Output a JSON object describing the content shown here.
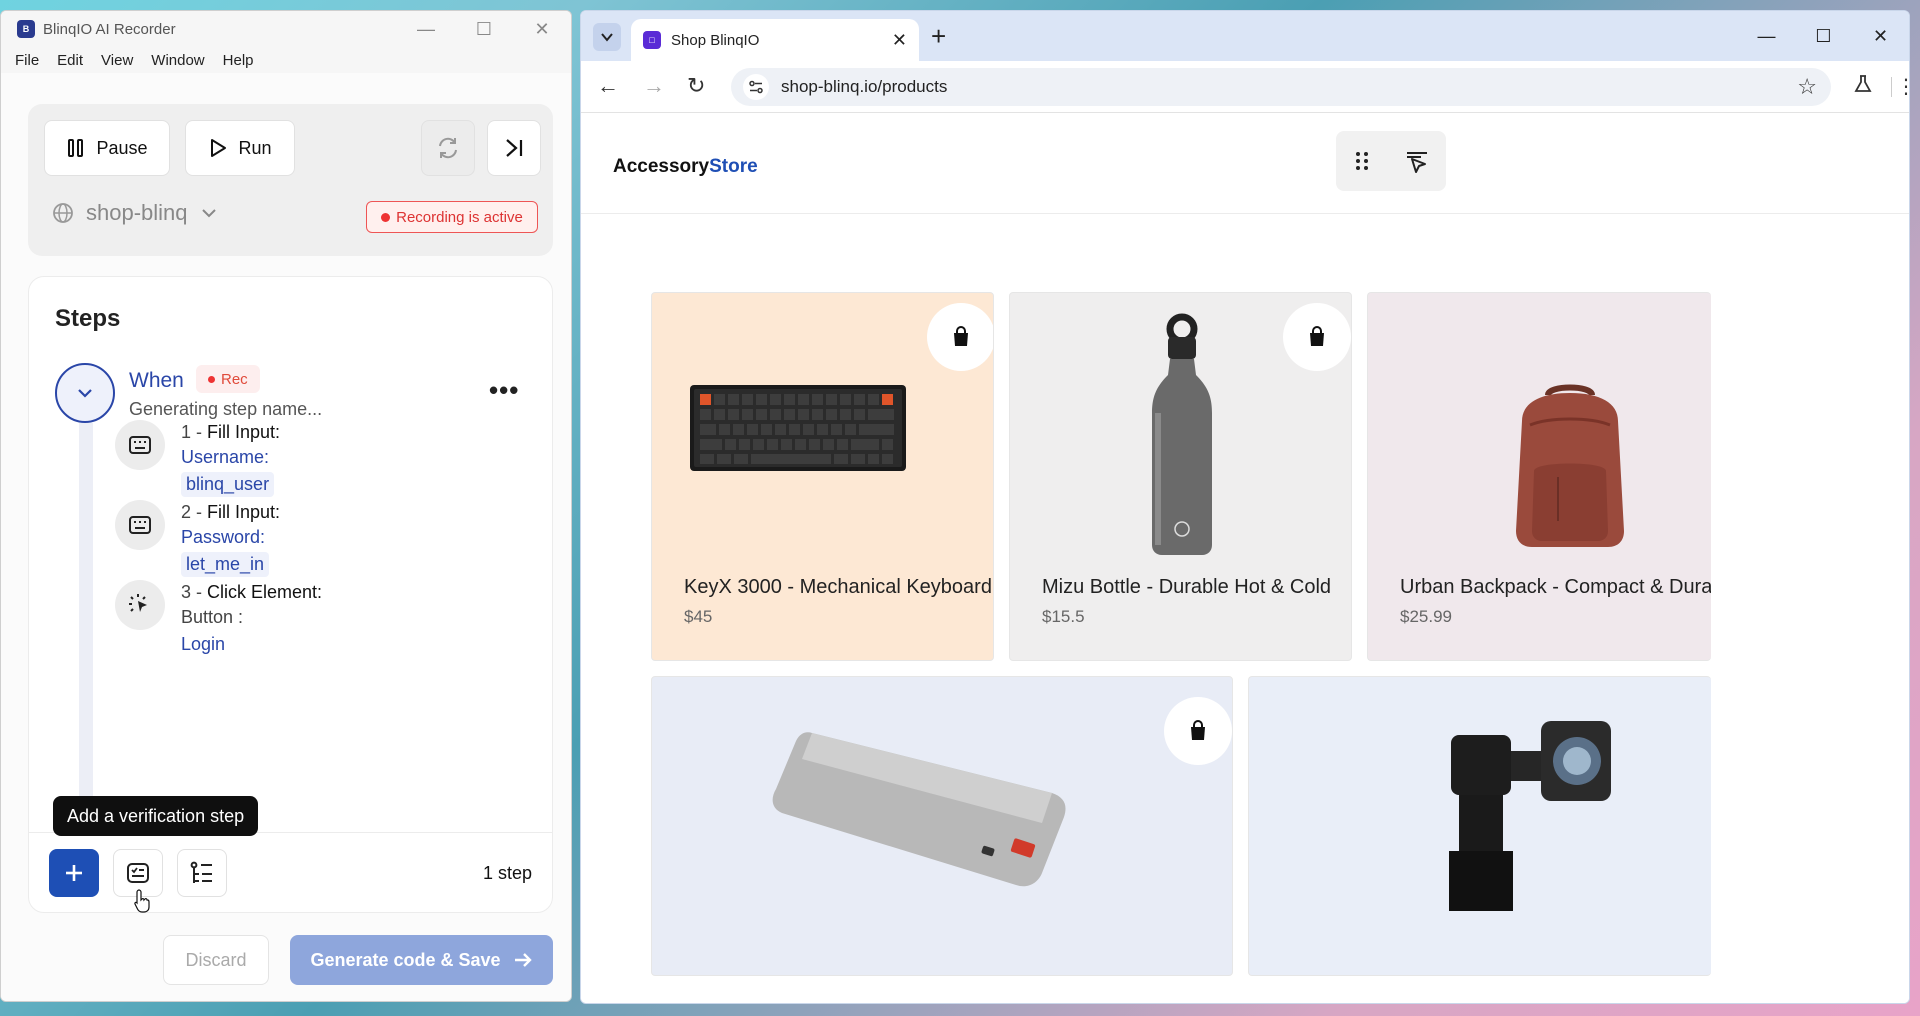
{
  "recorder": {
    "title": "BlinqIO AI Recorder",
    "menu": [
      "File",
      "Edit",
      "View",
      "Window",
      "Help"
    ],
    "controls": {
      "pause_label": "Pause",
      "run_label": "Run",
      "project_name": "shop-blinq",
      "recording_status": "Recording is active"
    },
    "steps_panel": {
      "title": "Steps",
      "when_label": "When",
      "rec_badge": "Rec",
      "when_subtitle": "Generating step name...",
      "steps": [
        {
          "num": "1 -",
          "title": "Fill Input:",
          "key": "Username:",
          "value": "blinq_user",
          "icon": "keyboard-icon"
        },
        {
          "num": "2 -",
          "title": "Fill Input:",
          "key": "Password:",
          "value": "let_me_in",
          "icon": "keyboard-icon"
        },
        {
          "num": "3 -",
          "title": "Click Element:",
          "key": "Button :",
          "value": "Login",
          "icon": "click-icon"
        }
      ],
      "step_count": "1 step",
      "tooltip": "Add a verification step"
    },
    "discard_label": "Discard",
    "generate_label": "Generate code & Save"
  },
  "browser": {
    "tab_title": "Shop BlinqIO",
    "url": "shop-blinq.io/products",
    "store": {
      "logo_part1": "Accessory",
      "logo_part2": "Store",
      "products": [
        {
          "name": "KeyX 3000 - Mechanical Keyboard",
          "price": "$45",
          "bg": "#fde8d4"
        },
        {
          "name": "Mizu Bottle - Durable Hot & Cold",
          "price": "$15.5",
          "bg": "#efeeee"
        },
        {
          "name": "Urban Backpack - Compact & Durable",
          "price": "$25.99",
          "bg": "#f0e8ec"
        },
        {
          "name": "",
          "price": "",
          "bg": "#e8ecf6"
        },
        {
          "name": "",
          "price": "",
          "bg": "#e9eef8"
        }
      ]
    }
  },
  "colors": {
    "brand_blue": "#1e4fb5",
    "rec_red": "#e33333",
    "link_blue": "#2a46a8"
  }
}
